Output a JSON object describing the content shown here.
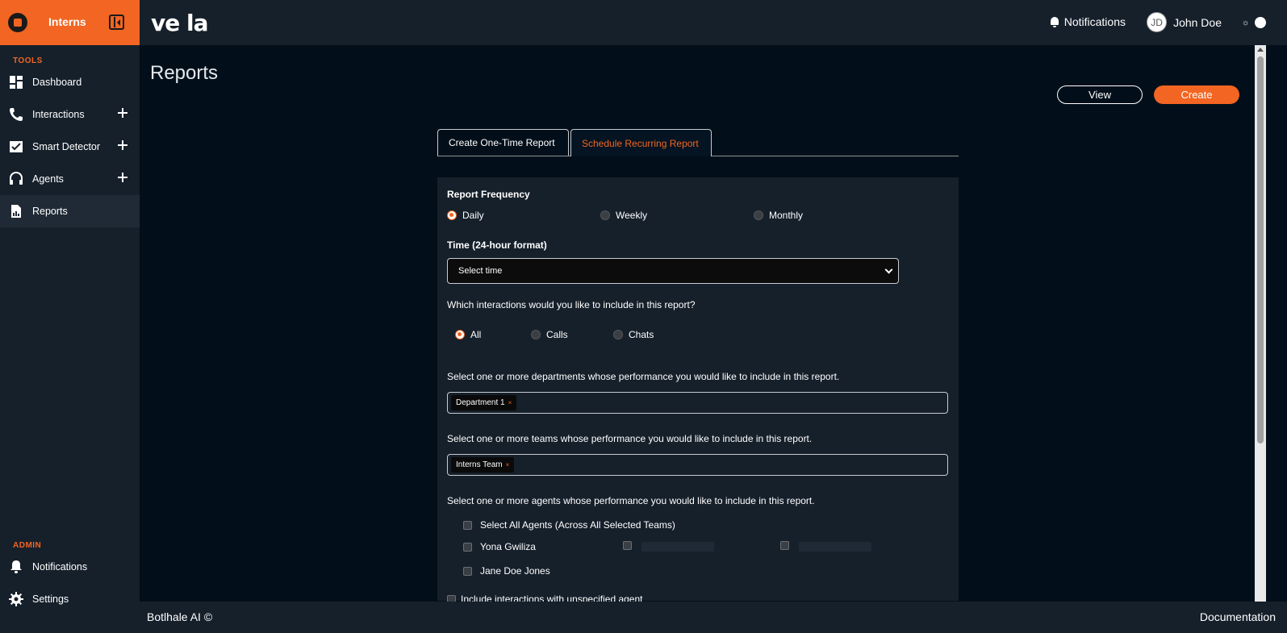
{
  "sidebar": {
    "org_name": "Interns",
    "tools_label": "TOOLS",
    "admin_label": "ADMIN",
    "items": [
      {
        "label": "Dashboard",
        "icon": "dashboard-icon"
      },
      {
        "label": "Interactions",
        "icon": "phone-icon"
      },
      {
        "label": "Smart Detector",
        "icon": "chart-check-icon"
      },
      {
        "label": "Agents",
        "icon": "headset-icon"
      },
      {
        "label": "Reports",
        "icon": "report-icon"
      }
    ],
    "admin_items": [
      {
        "label": "Notifications",
        "icon": "bell-icon"
      },
      {
        "label": "Settings",
        "icon": "gear-icon"
      }
    ]
  },
  "header": {
    "brand": "ve  la",
    "notifications_label": "Notifications",
    "user_initials": "JD",
    "user_name": "John Doe"
  },
  "page": {
    "title": "Reports",
    "view_button": "View",
    "create_button": "Create"
  },
  "tabs": [
    {
      "label": "Create One-Time Report"
    },
    {
      "label": "Schedule Recurring Report"
    }
  ],
  "form": {
    "frequency_label": "Report Frequency",
    "frequency_options": [
      "Daily",
      "Weekly",
      "Monthly"
    ],
    "frequency_selected": "Daily",
    "time_label": "Time (24-hour format)",
    "time_value": "Select time",
    "interactions_question": "Which interactions would you like to include in this report?",
    "interaction_options": [
      "All",
      "Calls",
      "Chats"
    ],
    "interaction_selected": "All",
    "departments_question": "Select one or more departments whose performance you would like to include in this report.",
    "departments_selected": [
      "Department 1"
    ],
    "teams_question": "Select one or more teams whose performance you would like to include in this report.",
    "teams_selected": [
      "Interns Team"
    ],
    "agents_question": "Select one or more agents whose performance you would like to include in this report.",
    "select_all_agents": "Select All Agents (Across All Selected Teams)",
    "agents": [
      "Yona Gwiliza",
      "Jane Doe Jones"
    ],
    "unspecified_agent": "Include interactions with unspecified agent",
    "chip_remove": "×"
  },
  "footer": {
    "left": "Botlhale AI ©",
    "right": "Documentation"
  }
}
